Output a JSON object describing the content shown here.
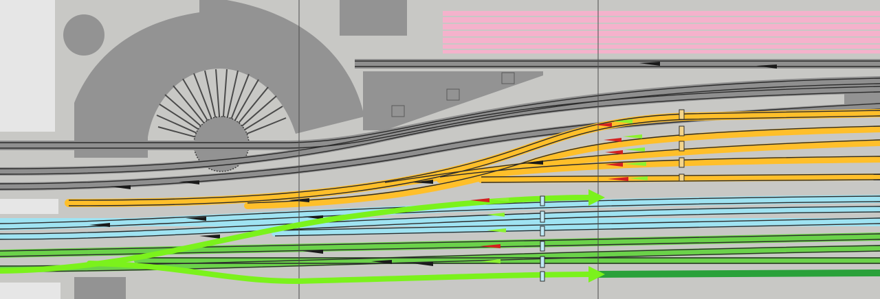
{
  "scene": {
    "type": "railway-yard-signal-box",
    "label_text": ""
  },
  "colors": {
    "ground": "#c8c8c5",
    "building": "#939393",
    "building_light": "#e6e6e6",
    "track_gray": "#8f8f8f",
    "track_yellow": "#ffbf2a",
    "track_blue": "#9fe3f2",
    "track_green": "#6bd24a",
    "track_green_dark": "#2aa13a",
    "track_pink": "#f5b2cc",
    "rail": "#1a1a1a",
    "route_arrow": "#7bf21c",
    "signal_red": "#d32020",
    "signal_green": "#8cf230"
  },
  "icons": {
    "turntable": "turntable-icon",
    "signal": "signal-icon",
    "buffer": "buffer-stop-icon",
    "route_arrow": "route-arrow-icon"
  },
  "routes": {
    "count": 2,
    "direction": "east"
  },
  "signals": {
    "yellow_group": [
      "red-green",
      "red-green",
      "red-green",
      "red-green",
      "red-green"
    ],
    "blue_green_group": [
      "red-green",
      "green",
      "green",
      "red",
      "green"
    ]
  }
}
